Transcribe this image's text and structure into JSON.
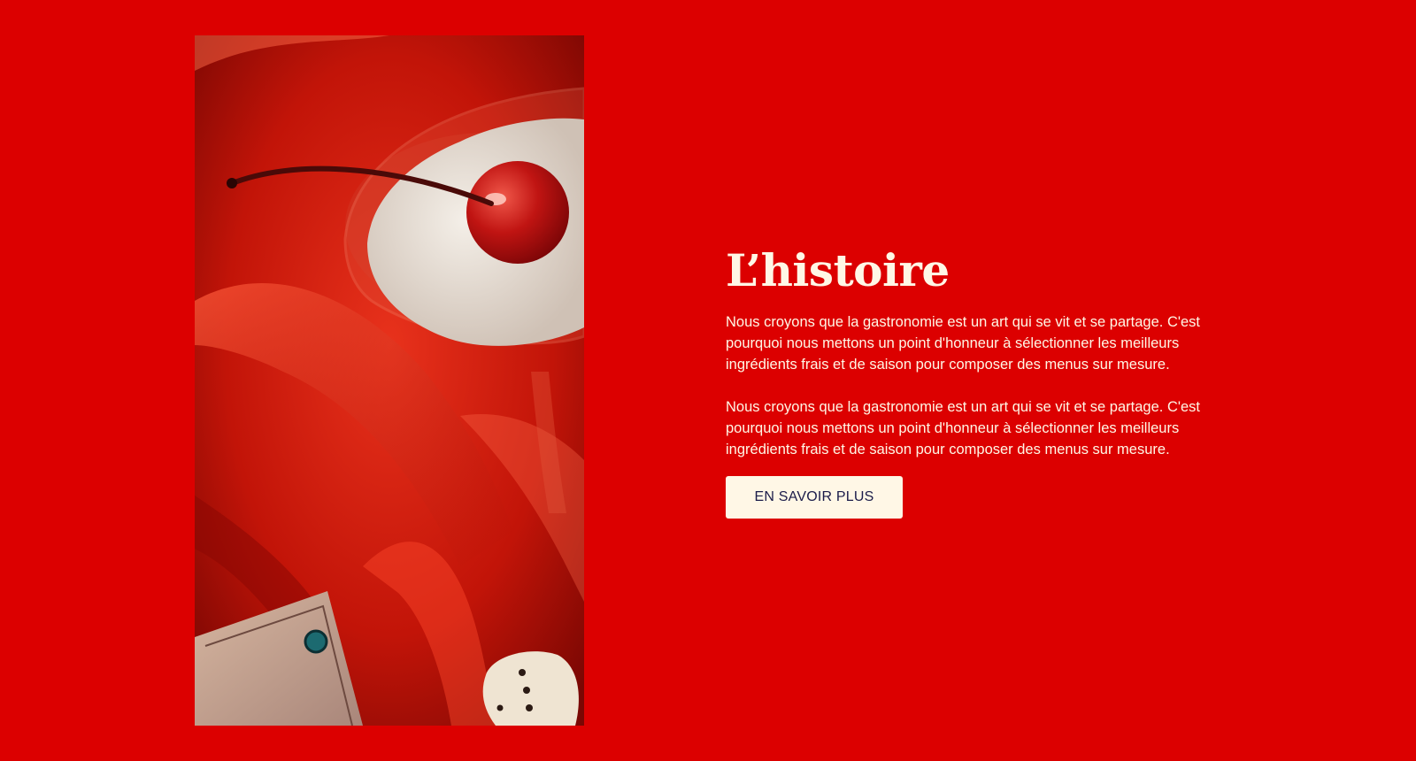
{
  "photo": {
    "image_description_icon": "dessert-photo-icon"
  },
  "section": {
    "title": "L’histoire",
    "paragraphs": [
      "Nous croyons que la gastronomie est un art qui se vit et se partage. C'est pourquoi nous mettons un point d'honneur à sélectionner les meilleurs ingrédients frais et de saison pour composer des menus sur mesure.",
      "Nous croyons que la gastronomie est un art qui se vit et se partage. C'est pourquoi nous mettons un point d'honneur à sélectionner les meilleurs ingrédients frais et de saison pour composer des menus sur mesure."
    ],
    "cta_label": "EN SAVOIR PLUS"
  },
  "colors": {
    "background": "#dc0000",
    "text": "#fff7e6",
    "button_bg": "#fff7e6",
    "button_text": "#1b1c4a"
  }
}
